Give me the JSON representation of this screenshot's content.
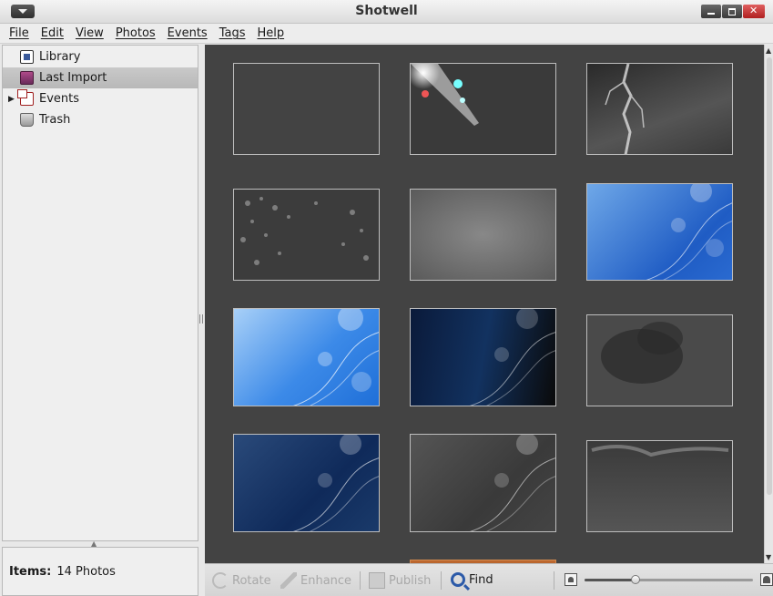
{
  "window": {
    "title": "Shotwell"
  },
  "menubar": {
    "items": [
      "File",
      "Edit",
      "View",
      "Photos",
      "Events",
      "Tags",
      "Help"
    ]
  },
  "sidebar": {
    "items": [
      {
        "label": "Library",
        "icon": "library-icon",
        "selected": false
      },
      {
        "label": "Last Import",
        "icon": "last-import-icon",
        "selected": true
      },
      {
        "label": "Events",
        "icon": "events-icon",
        "selected": false,
        "expandable": true
      },
      {
        "label": "Trash",
        "icon": "trash-icon",
        "selected": false
      }
    ],
    "footer": {
      "label": "Items:",
      "value": "14 Photos"
    }
  },
  "photos": [
    {
      "name": "photo-blank-dark"
    },
    {
      "name": "photo-light-burst"
    },
    {
      "name": "photo-lightning"
    },
    {
      "name": "photo-grunge-floral"
    },
    {
      "name": "photo-grey-texture"
    },
    {
      "name": "photo-blue-waves-1"
    },
    {
      "name": "photo-blue-waves-light"
    },
    {
      "name": "photo-blue-waves-dark"
    },
    {
      "name": "photo-smoke-cloud"
    },
    {
      "name": "photo-navy-waves"
    },
    {
      "name": "photo-grey-waves"
    },
    {
      "name": "photo-wispy-clouds"
    }
  ],
  "toolbar": {
    "rotate_label": "Rotate",
    "enhance_label": "Enhance",
    "publish_label": "Publish",
    "find_label": "Find",
    "zoom_fraction": 0.3
  }
}
